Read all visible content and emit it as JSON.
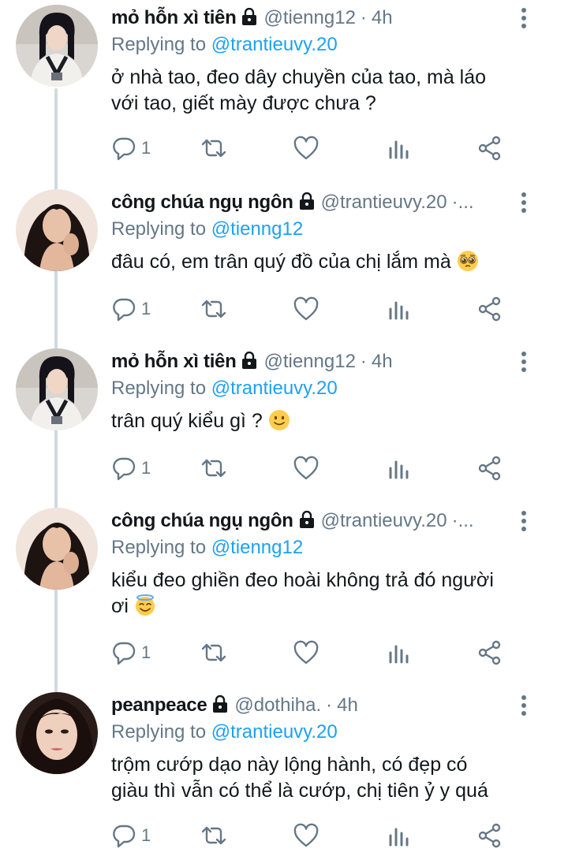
{
  "replies": [
    {
      "name": "mỏ hỗn xì tiên",
      "handle": "@tienng12",
      "sep": "·",
      "time": "4h",
      "replying_label": "Replying to",
      "replying_to": "@trantieuvy.20",
      "text_lines": [
        "ở nhà tao, đeo dây chuyền của tao, mà láo",
        "với tao, giết mày được chưa ?"
      ],
      "emoji": "",
      "reply_count": "1"
    },
    {
      "name": "công chúa ngụ ngôn",
      "handle": "@trantieuvy.20",
      "sep": "·...",
      "time": "",
      "replying_label": "Replying to",
      "replying_to": "@tienng12",
      "text_lines": [
        "đâu có, em trân quý đồ của chị lắm mà"
      ],
      "emoji": "pleading-face",
      "reply_count": "1"
    },
    {
      "name": "mỏ hỗn xì tiên",
      "handle": "@tienng12",
      "sep": "·",
      "time": "4h",
      "replying_label": "Replying to",
      "replying_to": "@trantieuvy.20",
      "text_lines": [
        "trân quý kiểu gì ?"
      ],
      "emoji": "slightly-smiling-face",
      "reply_count": "1"
    },
    {
      "name": "công chúa ngụ ngôn",
      "handle": "@trantieuvy.20",
      "sep": "·...",
      "time": "",
      "replying_label": "Replying to",
      "replying_to": "@tienng12",
      "text_lines": [
        "kiểu đeo ghiền đeo hoài không trả đó người",
        "ơi"
      ],
      "emoji": "smiling-face-with-halo",
      "reply_count": "1"
    },
    {
      "name": "peanpeace",
      "handle": "@dothiha.",
      "sep": "·",
      "time": "4h",
      "replying_label": "Replying to",
      "replying_to": "@trantieuvy.20",
      "text_lines": [
        "trộm cướp dạo này lộng hành, có đẹp có",
        "giàu thì vẫn có thể là cướp, chị tiên ỷ y quá"
      ],
      "emoji": "",
      "reply_count": "1"
    }
  ],
  "colors": {
    "link": "#1da1f2",
    "muted": "#657786",
    "text": "#14171a",
    "thread_line": "#cfd9de"
  },
  "icons": [
    "lock-icon",
    "more-icon",
    "reply-icon",
    "retweet-icon",
    "like-icon",
    "analytics-icon",
    "share-icon"
  ]
}
